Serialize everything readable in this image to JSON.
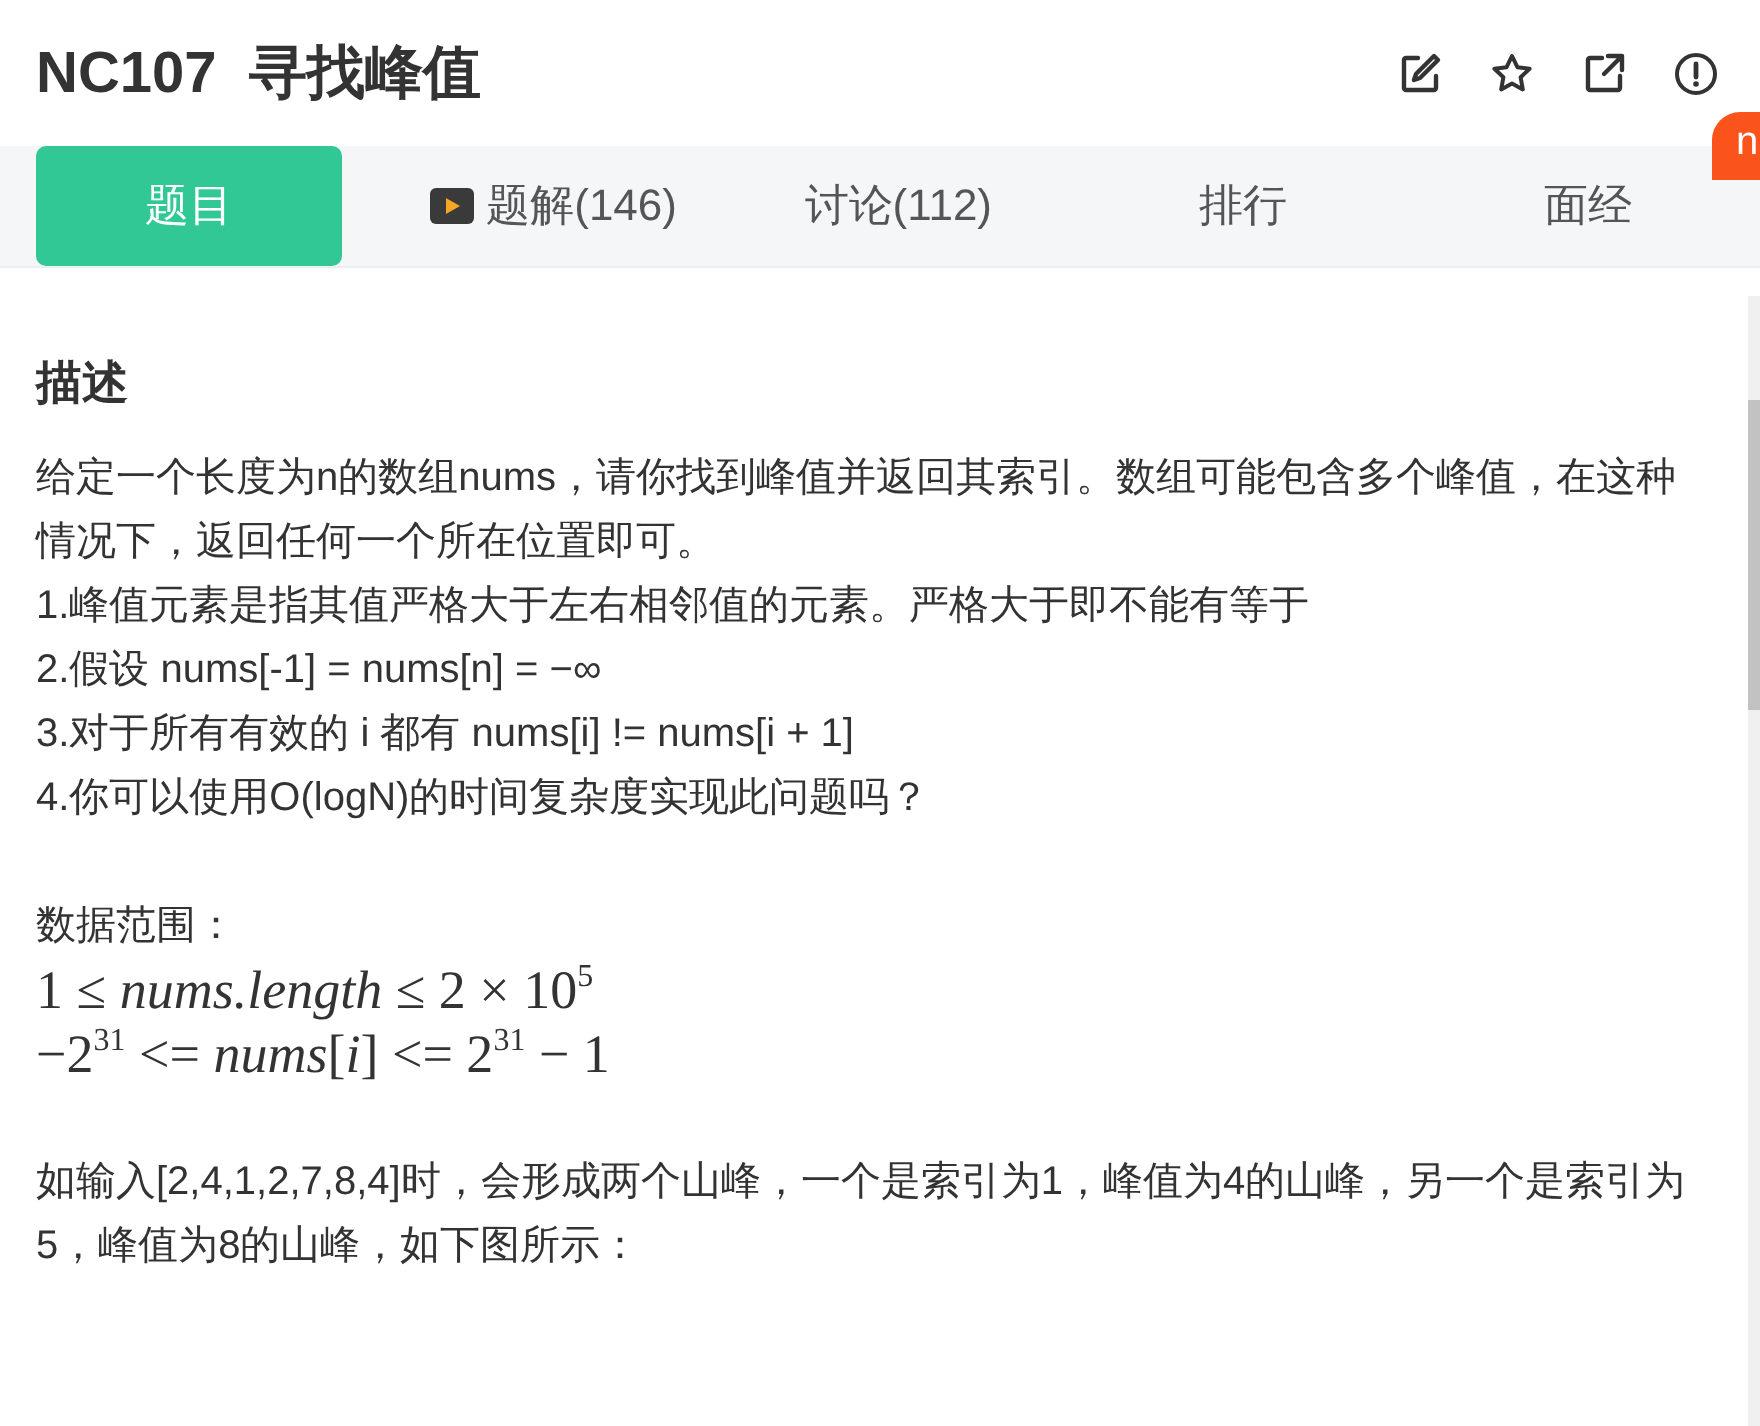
{
  "header": {
    "title": "NC107  寻找峰值"
  },
  "tabs": [
    {
      "label": "题目",
      "selected": true,
      "kind": "text"
    },
    {
      "label": "题解(146)",
      "selected": false,
      "kind": "video"
    },
    {
      "label": "讨论(112)",
      "selected": false,
      "kind": "text"
    },
    {
      "label": "排行",
      "selected": false,
      "kind": "text"
    },
    {
      "label": "面经",
      "selected": false,
      "kind": "text"
    }
  ],
  "badge": {
    "text": "n"
  },
  "content": {
    "heading": "描述",
    "blocks": [
      {
        "kind": "text",
        "text": "给定一个长度为n的数组nums，请你找到峰值并返回其索引。数组可能包含多个峰值，在这种情况下，返回任何一个所在位置即可。"
      },
      {
        "kind": "text",
        "text": "1.峰值元素是指其值严格大于左右相邻值的元素。严格大于即不能有等于"
      },
      {
        "kind": "text",
        "text": "2.假设 nums[-1] = nums[n] = −∞"
      },
      {
        "kind": "text",
        "text": "3.对于所有有效的 i 都有 nums[i] != nums[i + 1]"
      },
      {
        "kind": "text",
        "text": "4.你可以使用O(logN)的时间复杂度实现此问题吗？"
      },
      {
        "kind": "gap"
      },
      {
        "kind": "text",
        "text": "数据范围："
      },
      {
        "kind": "math",
        "text": "1 ≤ *nums.length* ≤ 2 × 10$^{5}$"
      },
      {
        "kind": "math",
        "text": "−2$^{31}$ <= *nums*[*i*] <= 2$^{31}$ − 1"
      },
      {
        "kind": "gap"
      },
      {
        "kind": "text",
        "text": "如输入[2,4,1,2,7,8,4]时，会形成两个山峰，一个是索引为1，峰值为4的山峰，另一个是索引为5，峰值为8的山峰，如下图所示："
      }
    ]
  }
}
